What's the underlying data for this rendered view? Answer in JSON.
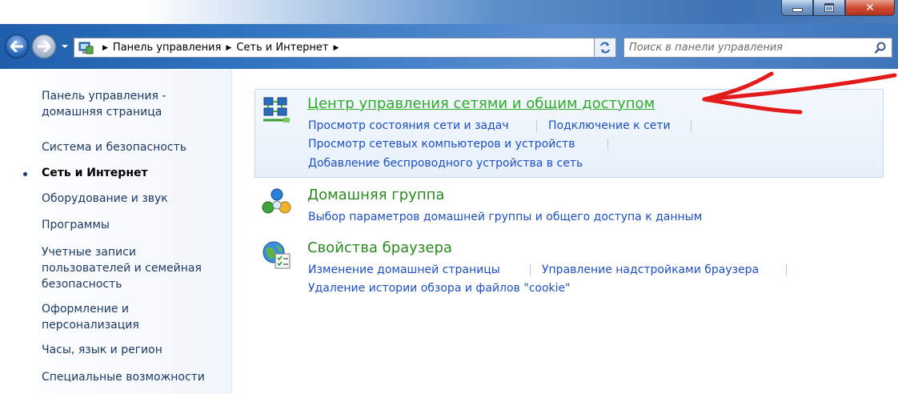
{
  "address": {
    "crumbs": [
      "Панель управления",
      "Сеть и Интернет"
    ]
  },
  "search": {
    "placeholder": "Поиск в панели управления"
  },
  "sidebar": {
    "items": [
      {
        "label": "Панель управления - домашняя страница"
      },
      {
        "label": "Система и безопасность"
      },
      {
        "label": "Сеть и Интернет"
      },
      {
        "label": "Оборудование и звук"
      },
      {
        "label": "Программы"
      },
      {
        "label": "Учетные записи пользователей и семейная безопасность"
      },
      {
        "label": "Оформление и персонализация"
      },
      {
        "label": "Часы, язык и регион"
      },
      {
        "label": "Специальные возможности"
      }
    ]
  },
  "categories": [
    {
      "title": "Центр управления сетями и общим доступом",
      "links": [
        "Просмотр состояния сети и задач",
        "Подключение к сети",
        "Просмотр сетевых компьютеров и устройств",
        "Добавление беспроводного устройства в сеть"
      ]
    },
    {
      "title": "Домашняя группа",
      "links": [
        "Выбор параметров домашней группы и общего доступа к данным"
      ]
    },
    {
      "title": "Свойства браузера",
      "links": [
        "Изменение домашней страницы",
        "Управление надстройками браузера",
        "Удаление истории обзора и файлов \"cookie\""
      ]
    }
  ],
  "icons": {
    "back": "back-arrow-icon",
    "forward": "forward-arrow-icon",
    "address": "control-panel-icon",
    "refresh": "refresh-icon",
    "search": "search-icon",
    "network": "network-center-icon",
    "homegroup": "homegroup-icon",
    "browser": "browser-properties-icon"
  },
  "colors": {
    "link": "#1c4fc4",
    "category_title": "#2a8a1f",
    "annotation_arrow": "#e31b1b"
  }
}
